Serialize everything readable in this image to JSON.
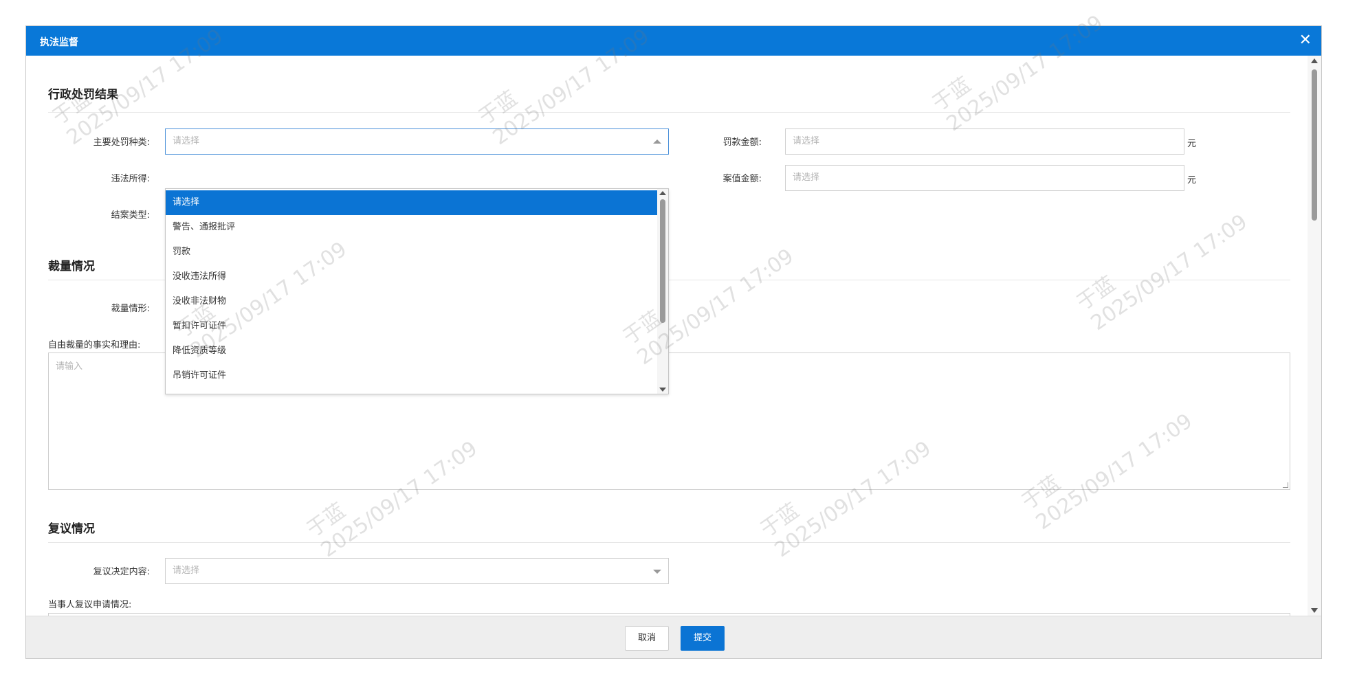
{
  "window": {
    "title": "执法监督",
    "close_icon": "✕"
  },
  "colors": {
    "header": "#0978d8",
    "accent": "#0b74d4"
  },
  "sections": {
    "penalty_result": {
      "title": "行政处罚结果",
      "main_type_label": "主要处罚种类:",
      "main_type_placeholder": "请选择",
      "fine_label": "罚款金额:",
      "fine_placeholder": "请选择",
      "fine_unit": "元",
      "illegal_income_label": "违法所得:",
      "case_value_label": "案值金额:",
      "case_value_placeholder": "请选择",
      "case_value_unit": "元",
      "close_type_label": "结案类型:"
    },
    "discretion": {
      "title": "裁量情况",
      "situation_label": "裁量情形:",
      "facts_label": "自由裁量的事实和理由:",
      "facts_placeholder": "请输入"
    },
    "review": {
      "title": "复议情况",
      "decision_label": "复议决定内容:",
      "decision_placeholder": "请选择",
      "party_label": "当事人复议申请情况:"
    }
  },
  "dropdown": {
    "items": [
      "请选择",
      "警告、通报批评",
      "罚款",
      "没收违法所得",
      "没收非法财物",
      "暂扣许可证件",
      "降低资质等级",
      "吊销许可证件"
    ],
    "selected_index": 0
  },
  "footer": {
    "cancel_label": "取消",
    "submit_label": "提交"
  },
  "watermark": {
    "name": "于蓝",
    "datetime": "2025/09/17 17:09"
  }
}
